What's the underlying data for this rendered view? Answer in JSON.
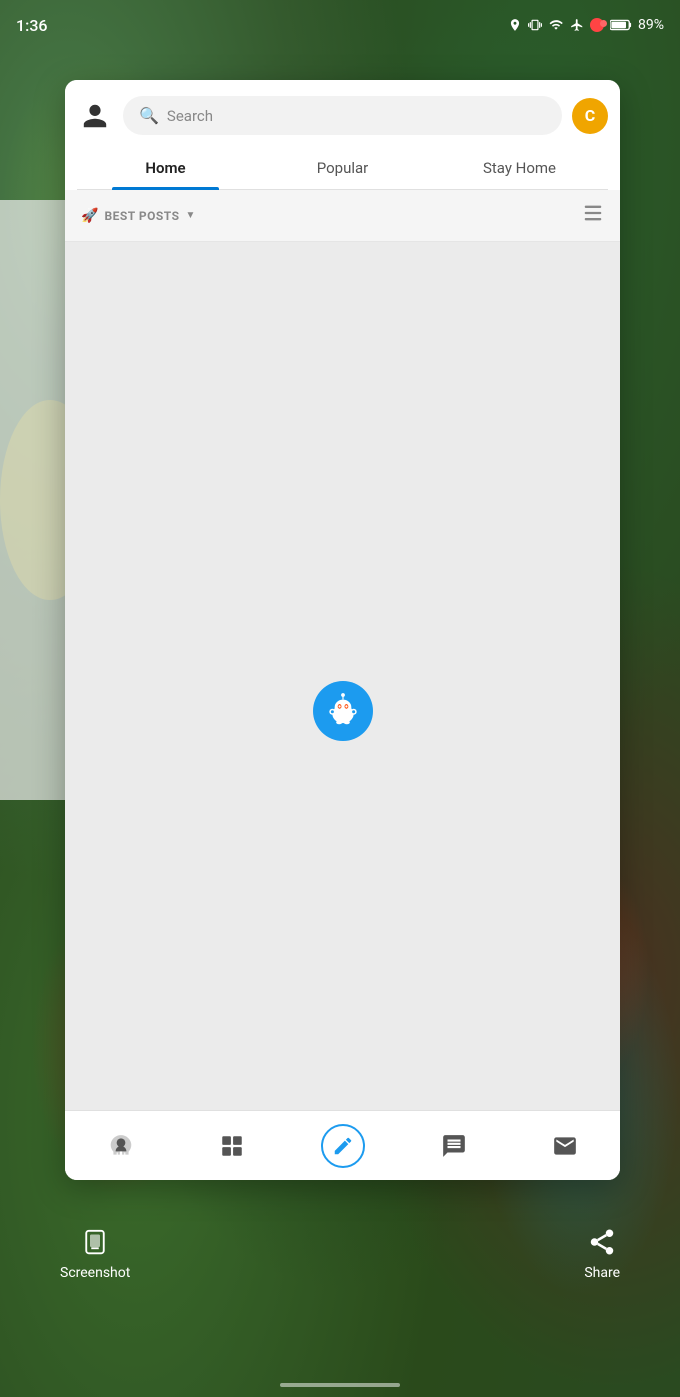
{
  "status_bar": {
    "time": "1:36",
    "battery_percent": "89%",
    "icons": [
      "location",
      "vibrate",
      "wifi",
      "airplane",
      "record",
      "battery"
    ]
  },
  "search": {
    "placeholder": "Search"
  },
  "tabs": [
    {
      "label": "Home",
      "active": true
    },
    {
      "label": "Popular",
      "active": false
    },
    {
      "label": "Stay Home",
      "active": false
    }
  ],
  "filter": {
    "label": "BEST POSTS"
  },
  "coin_label": "C",
  "bottom_nav": [
    {
      "id": "home",
      "label": "home"
    },
    {
      "id": "communities",
      "label": "communities"
    },
    {
      "id": "create",
      "label": "create",
      "active": true
    },
    {
      "id": "chat",
      "label": "chat"
    },
    {
      "id": "inbox",
      "label": "inbox"
    }
  ],
  "system_actions": [
    {
      "id": "screenshot",
      "label": "Screenshot"
    },
    {
      "id": "share",
      "label": "Share"
    }
  ]
}
